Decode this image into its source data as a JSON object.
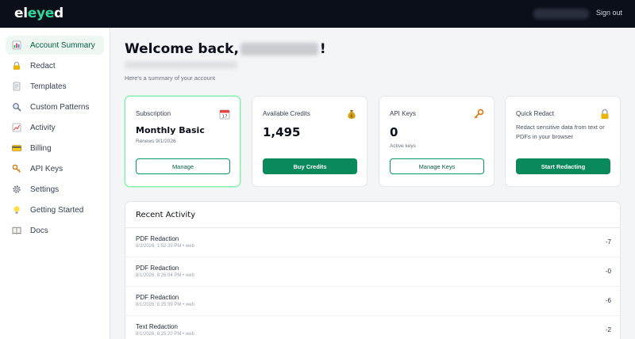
{
  "app": {
    "logo_text_1": "el",
    "logo_text_2": "eye",
    "logo_text_3": "d",
    "signout_label": "Sign out",
    "accent_color": "#0a8a5a"
  },
  "sidebar": {
    "items": [
      {
        "label": "Account Summary",
        "icon": "bar-chart-icon",
        "active": true
      },
      {
        "label": "Redact",
        "icon": "lock-icon"
      },
      {
        "label": "Templates",
        "icon": "document-icon"
      },
      {
        "label": "Custom Patterns",
        "icon": "magnifier-icon"
      },
      {
        "label": "Activity",
        "icon": "line-chart-icon"
      },
      {
        "label": "Billing",
        "icon": "credit-card-icon"
      },
      {
        "label": "API Keys",
        "icon": "key-icon"
      },
      {
        "label": "Settings",
        "icon": "gear-icon"
      },
      {
        "label": "Getting Started",
        "icon": "lightbulb-icon"
      },
      {
        "label": "Docs",
        "icon": "book-icon"
      }
    ]
  },
  "main": {
    "welcome_prefix": "Welcome back,",
    "welcome_suffix": "!",
    "summary_text": "Here's a summary of your account"
  },
  "cards": {
    "subscription": {
      "title": "Subscription",
      "icon": "calendar-icon",
      "value": "Monthly Basic",
      "sub": "Renews 9/1/2026",
      "button": "Manage"
    },
    "credits": {
      "title": "Available Credits",
      "icon": "money-bag-icon",
      "value": "1,495",
      "button": "Buy Credits"
    },
    "api_keys": {
      "title": "API Keys",
      "icon": "key-icon",
      "value": "0",
      "sub": "Active keys",
      "button": "Manage Keys"
    },
    "quick_redact": {
      "title": "Quick Redact",
      "icon": "lock-icon",
      "desc": "Redact sensitive data from text or PDFs in your browser",
      "button": "Start Redacting"
    }
  },
  "activity": {
    "title": "Recent Activity",
    "rows": [
      {
        "title": "PDF Redaction",
        "meta": "8/2/2026, 1:52:35 PM • web",
        "amount": "-7"
      },
      {
        "title": "PDF Redaction",
        "meta": "8/1/2026, 8:26:04 PM • web",
        "amount": "-0"
      },
      {
        "title": "PDF Redaction",
        "meta": "8/1/2026, 8:25:39 PM • web",
        "amount": "-6"
      },
      {
        "title": "Text Redaction",
        "meta": "8/1/2026, 8:25:20 PM • web",
        "amount": "-2"
      }
    ]
  }
}
